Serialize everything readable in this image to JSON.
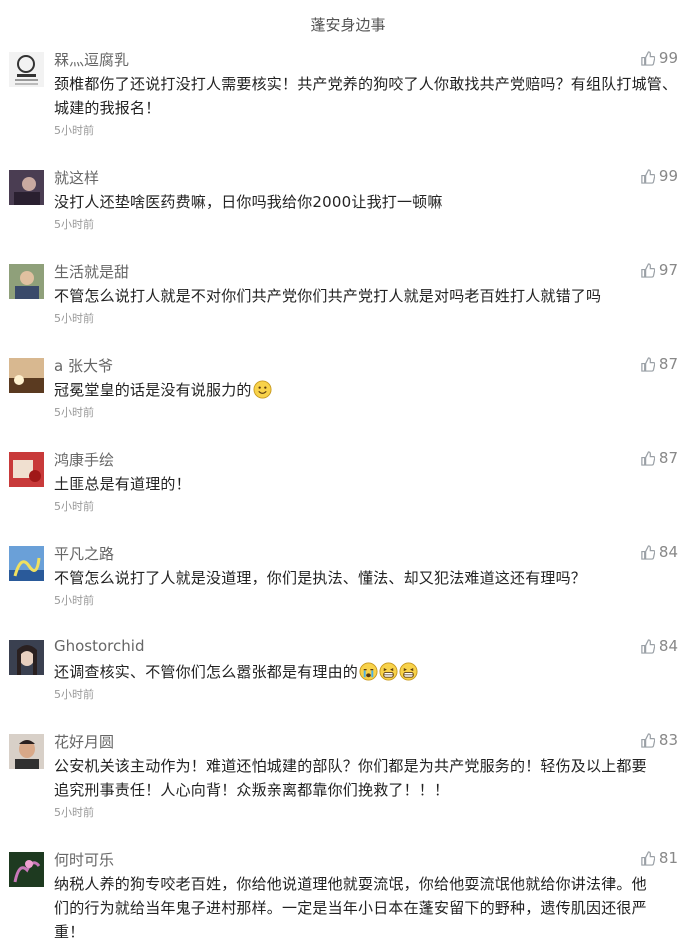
{
  "header": {
    "title": "蓬安身边事"
  },
  "comments": [
    {
      "name": "槑灬逗腐乳",
      "likes": "99",
      "text": "颈椎都伤了还说打没打人需要核实！共产党养的狗咬了人你敢找共产党赔吗？有组队打城管、城建的我报名！",
      "time": "5小时前",
      "avatar_color": "#e9e9e9"
    },
    {
      "name": "就这样",
      "likes": "99",
      "text": "没打人还垫啥医药费嘛，日你吗我给你2000让我打一顿嘛",
      "time": "5小时前",
      "avatar_color": "#4a3d52"
    },
    {
      "name": "生活就是甜",
      "likes": "97",
      "text": "不管怎么说打人就是不对你们共产党你们共产党打人就是对吗老百姓打人就错了吗",
      "time": "5小时前",
      "avatar_color": "#6b7c5a"
    },
    {
      "name": "a  张大爷",
      "likes": "87",
      "text": "冠冕堂皇的话是没有说服力的",
      "time": "5小时前",
      "avatar_color": "#7a5a3a"
    },
    {
      "name": "鸿康手绘",
      "likes": "87",
      "text": "土匪总是有道理的！",
      "time": "5小时前",
      "avatar_color": "#b8323a"
    },
    {
      "name": "平凡之路",
      "likes": "84",
      "text": "不管怎么说打了人就是没道理，你们是执法、懂法、却又犯法难道这还有理吗？",
      "time": "5小时前",
      "avatar_color": "#4a7fb8"
    },
    {
      "name": "Ghostorchid",
      "likes": "84",
      "text": "还调查核实、不管你们怎么嚣张都是有理由的",
      "time": "5小时前",
      "avatar_color": "#3a4050"
    },
    {
      "name": "花好月圆",
      "likes": "83",
      "text_lines": [
        "公安机关该主动作为！难道还怕城建的部队？你们都是为共产党服务的！轻伤及以上都要",
        "追究刑事责任！人心向背！众叛亲离都靠你们挽救了！！！"
      ],
      "time": "5小时前",
      "avatar_color": "#b9b2a8"
    },
    {
      "name": "何时可乐",
      "likes": "81",
      "text_lines": [
        "纳税人养的狗专咬老百姓，你给他说道理他就耍流氓，你给他耍流氓他就给你讲法律。他",
        "们的行为就给当年鬼子进村那样。一定是当年小日本在蓬安留下的野种，遗传肌因还很严",
        "重！"
      ],
      "time": "",
      "avatar_color": "#2e4a2e"
    }
  ],
  "colors": {
    "like_icon": "#9aa0a6",
    "time": "#999999",
    "name": "#666666"
  },
  "icons": {
    "like": "thumbs-up-icon",
    "emoji": "smile-emoji",
    "cry": "crying-emoji",
    "grin": "grinning-emoji"
  }
}
